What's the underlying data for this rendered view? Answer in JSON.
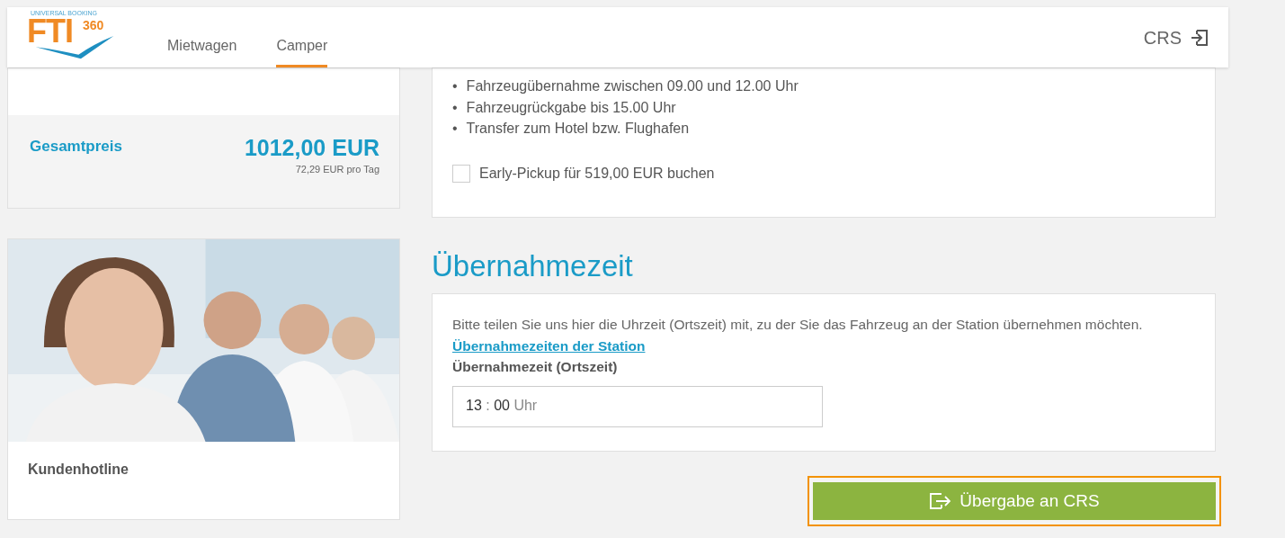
{
  "header": {
    "logo": {
      "top": "UNIVERSAL BOOKING",
      "brand": "FTI",
      "sup": "360"
    },
    "tabs": [
      {
        "label": "Mietwagen",
        "selected": false
      },
      {
        "label": "Camper",
        "selected": true
      }
    ],
    "crs_link": "CRS"
  },
  "sidebar": {
    "price": {
      "label": "Gesamtpreis",
      "amount": "1012,00 EUR",
      "per_day": "72,29 EUR pro Tag"
    },
    "hotline": {
      "label": "Kundenhotline"
    }
  },
  "details": {
    "bullets": [
      {
        "marker": "•",
        "text": "Fahrzeugübernahme zwischen 09.00 und 12.00 Uhr"
      },
      {
        "marker": "•",
        "text": "Fahrzeugrückgabe bis 15.00 Uhr"
      },
      {
        "marker": "•",
        "text": "Transfer zum Hotel bzw. Flughafen"
      }
    ],
    "early_pickup": {
      "label": "Early-Pickup für 519,00 EUR buchen",
      "checked": false
    }
  },
  "pickup_time": {
    "heading": "Übernahmezeit",
    "text": "Bitte teilen Sie uns hier die Uhrzeit (Ortszeit) mit, zu der Sie das Fahrzeug an der Station übernehmen möchten.",
    "link": "Übernahmezeiten der Station",
    "field_label": "Übernahmezeit (Ortszeit)",
    "hours": "13",
    "separator": ":",
    "minutes": "00",
    "unit": "Uhr"
  },
  "submit_button": "Übergabe an CRS"
}
